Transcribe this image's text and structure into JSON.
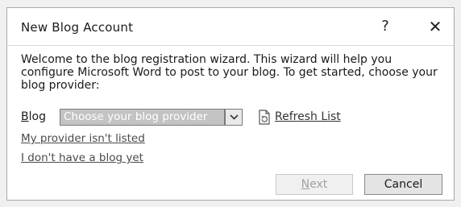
{
  "dialog": {
    "title": "New Blog Account",
    "help_glyph": "?",
    "close_glyph": "✕",
    "intro_text": "Welcome to the blog registration wizard. This wizard will help you configure Microsoft Word to post to your blog. To get started, choose your blog provider:",
    "blog_label_mnemonic": "B",
    "blog_label_rest": "log",
    "provider_select_value": "Choose your blog provider",
    "refresh_label": "Refresh List",
    "provider_not_listed_link": "My provider isn't listed",
    "no_blog_link": "I don't have a blog yet",
    "next_mnemonic": "N",
    "next_rest": "ext",
    "next_enabled": false,
    "cancel_label": "Cancel"
  },
  "icons": {
    "help": "question-mark-icon",
    "close": "close-icon",
    "dropdown": "chevron-down-icon",
    "refresh": "refresh-icon"
  }
}
